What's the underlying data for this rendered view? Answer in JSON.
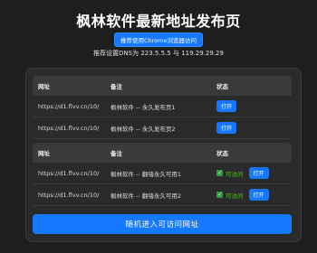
{
  "header": {
    "title": "枫林软件最新地址发布页",
    "chrome_button": "推荐使用Chrome浏览器访问",
    "dns_text": "推荐设置DNS为 223.5.5.5 与 119.29.29.29"
  },
  "columns": {
    "url": "网址",
    "note": "备注",
    "status": "状态"
  },
  "table1": {
    "rows": [
      {
        "url": "https://d1.flvv.cn/10/",
        "note": "枫林软件 -- 永久发布页1",
        "button": "打开"
      },
      {
        "url": "https://d1.flvv.cn/10/",
        "note": "枫林软件 -- 永久发布页2",
        "button": "打开"
      }
    ]
  },
  "table2": {
    "rows": [
      {
        "url": "https://d1.flvv.cn/10/",
        "note": "枫林软件 -- 翻墙永久可用1",
        "status": "可访问",
        "button": "打开"
      },
      {
        "url": "https://d1.flvv.cn/10/",
        "note": "枫林软件 -- 翻墙永久可用2",
        "status": "可访问",
        "button": "打开"
      }
    ]
  },
  "random_button": "随机进入可访问网址",
  "colors": {
    "accent": "#1677ff",
    "background": "#1e1e1e",
    "card": "#2a2a2a",
    "success": "#52c41a"
  },
  "icons": {
    "status_ok": "check-icon"
  }
}
